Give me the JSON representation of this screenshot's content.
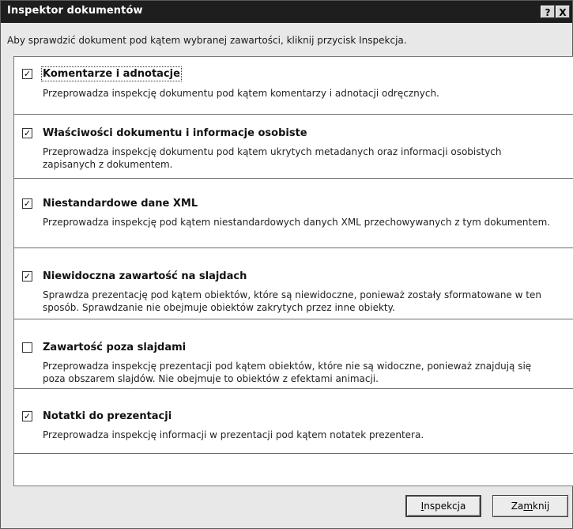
{
  "window": {
    "title": "Inspektor dokumentów",
    "help_label": "?",
    "close_label": "X"
  },
  "instruction": "Aby sprawdzić dokument pod kątem wybranej zawartości, kliknij przycisk Inspekcja.",
  "items": [
    {
      "checked": true,
      "mark": "✓",
      "title": "Komentarze i adnotacje",
      "description": "Przeprowadza inspekcję dokumentu pod kątem komentarzy i adnotacji odręcznych."
    },
    {
      "checked": true,
      "mark": "✓",
      "title": "Właściwości dokumentu i informacje osobiste",
      "description": "Przeprowadza inspekcję dokumentu pod kątem ukrytych metadanych oraz informacji osobistych zapisanych z dokumentem."
    },
    {
      "checked": true,
      "mark": "✓",
      "title": "Niestandardowe dane XML",
      "description": "Przeprowadza inspekcję pod kątem niestandardowych danych XML przechowywanych z tym dokumentem."
    },
    {
      "checked": true,
      "mark": "✓",
      "title": "Niewidoczna zawartość na slajdach",
      "description": "Sprawdza prezentację pod kątem obiektów, które są niewidoczne, ponieważ zostały sformatowane w ten sposób. Sprawdzanie nie obejmuje obiektów zakrytych przez inne obiekty."
    },
    {
      "checked": false,
      "mark": "",
      "title": "Zawartość poza slajdami",
      "description": "Przeprowadza inspekcję prezentacji pod kątem obiektów, które nie są widoczne, ponieważ znajdują się poza obszarem slajdów. Nie obejmuje to obiektów z efektami animacji."
    },
    {
      "checked": true,
      "mark": "✓",
      "title": "Notatki do prezentacji",
      "description": "Przeprowadza inspekcję informacji w prezentacji pod kątem notatek prezentera."
    }
  ],
  "buttons": {
    "inspect_first": "I",
    "inspect_rest": "nspekcja",
    "close_pre": "Za",
    "close_mnemonic": "m",
    "close_post": "knij"
  }
}
